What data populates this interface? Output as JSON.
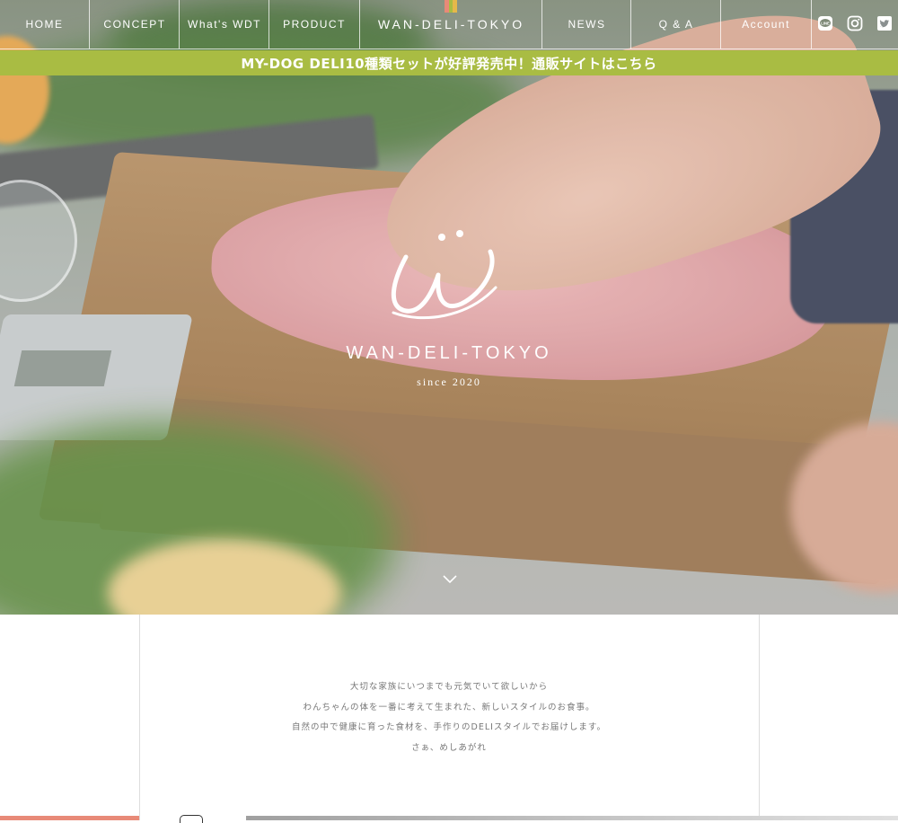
{
  "nav": {
    "items": [
      {
        "label": "HOME"
      },
      {
        "label": "CONCEPT"
      },
      {
        "label": "What's WDT"
      },
      {
        "label": "PRODUCT"
      },
      {
        "label": "NEWS"
      },
      {
        "label": "Q & A"
      },
      {
        "label": "Account"
      }
    ],
    "logo": "WAN-DELI-TOKYO",
    "social": [
      {
        "icon": "line-icon"
      },
      {
        "icon": "instagram-icon"
      },
      {
        "icon": "twitter-icon"
      }
    ]
  },
  "banner": {
    "text": "MY-DOG DELI10種類セットが好評発売中！通販サイトはこちら"
  },
  "hero": {
    "brand": "WAN-DELI-TOKYO",
    "since": "since 2020"
  },
  "concept": {
    "lines": [
      "大切な家族にいつまでも元気でいて欲しいから",
      "わんちゃんの体を一番に考えて生まれた、新しいスタイルのお食事。",
      "自然の中で健康に育った食材を、手作りのDELIスタイルでお届けします。",
      "さぁ、めしあがれ"
    ]
  },
  "colors": {
    "banner": "#a9bc43",
    "accent_coral": "#e88a78",
    "text_gray": "#777777"
  }
}
